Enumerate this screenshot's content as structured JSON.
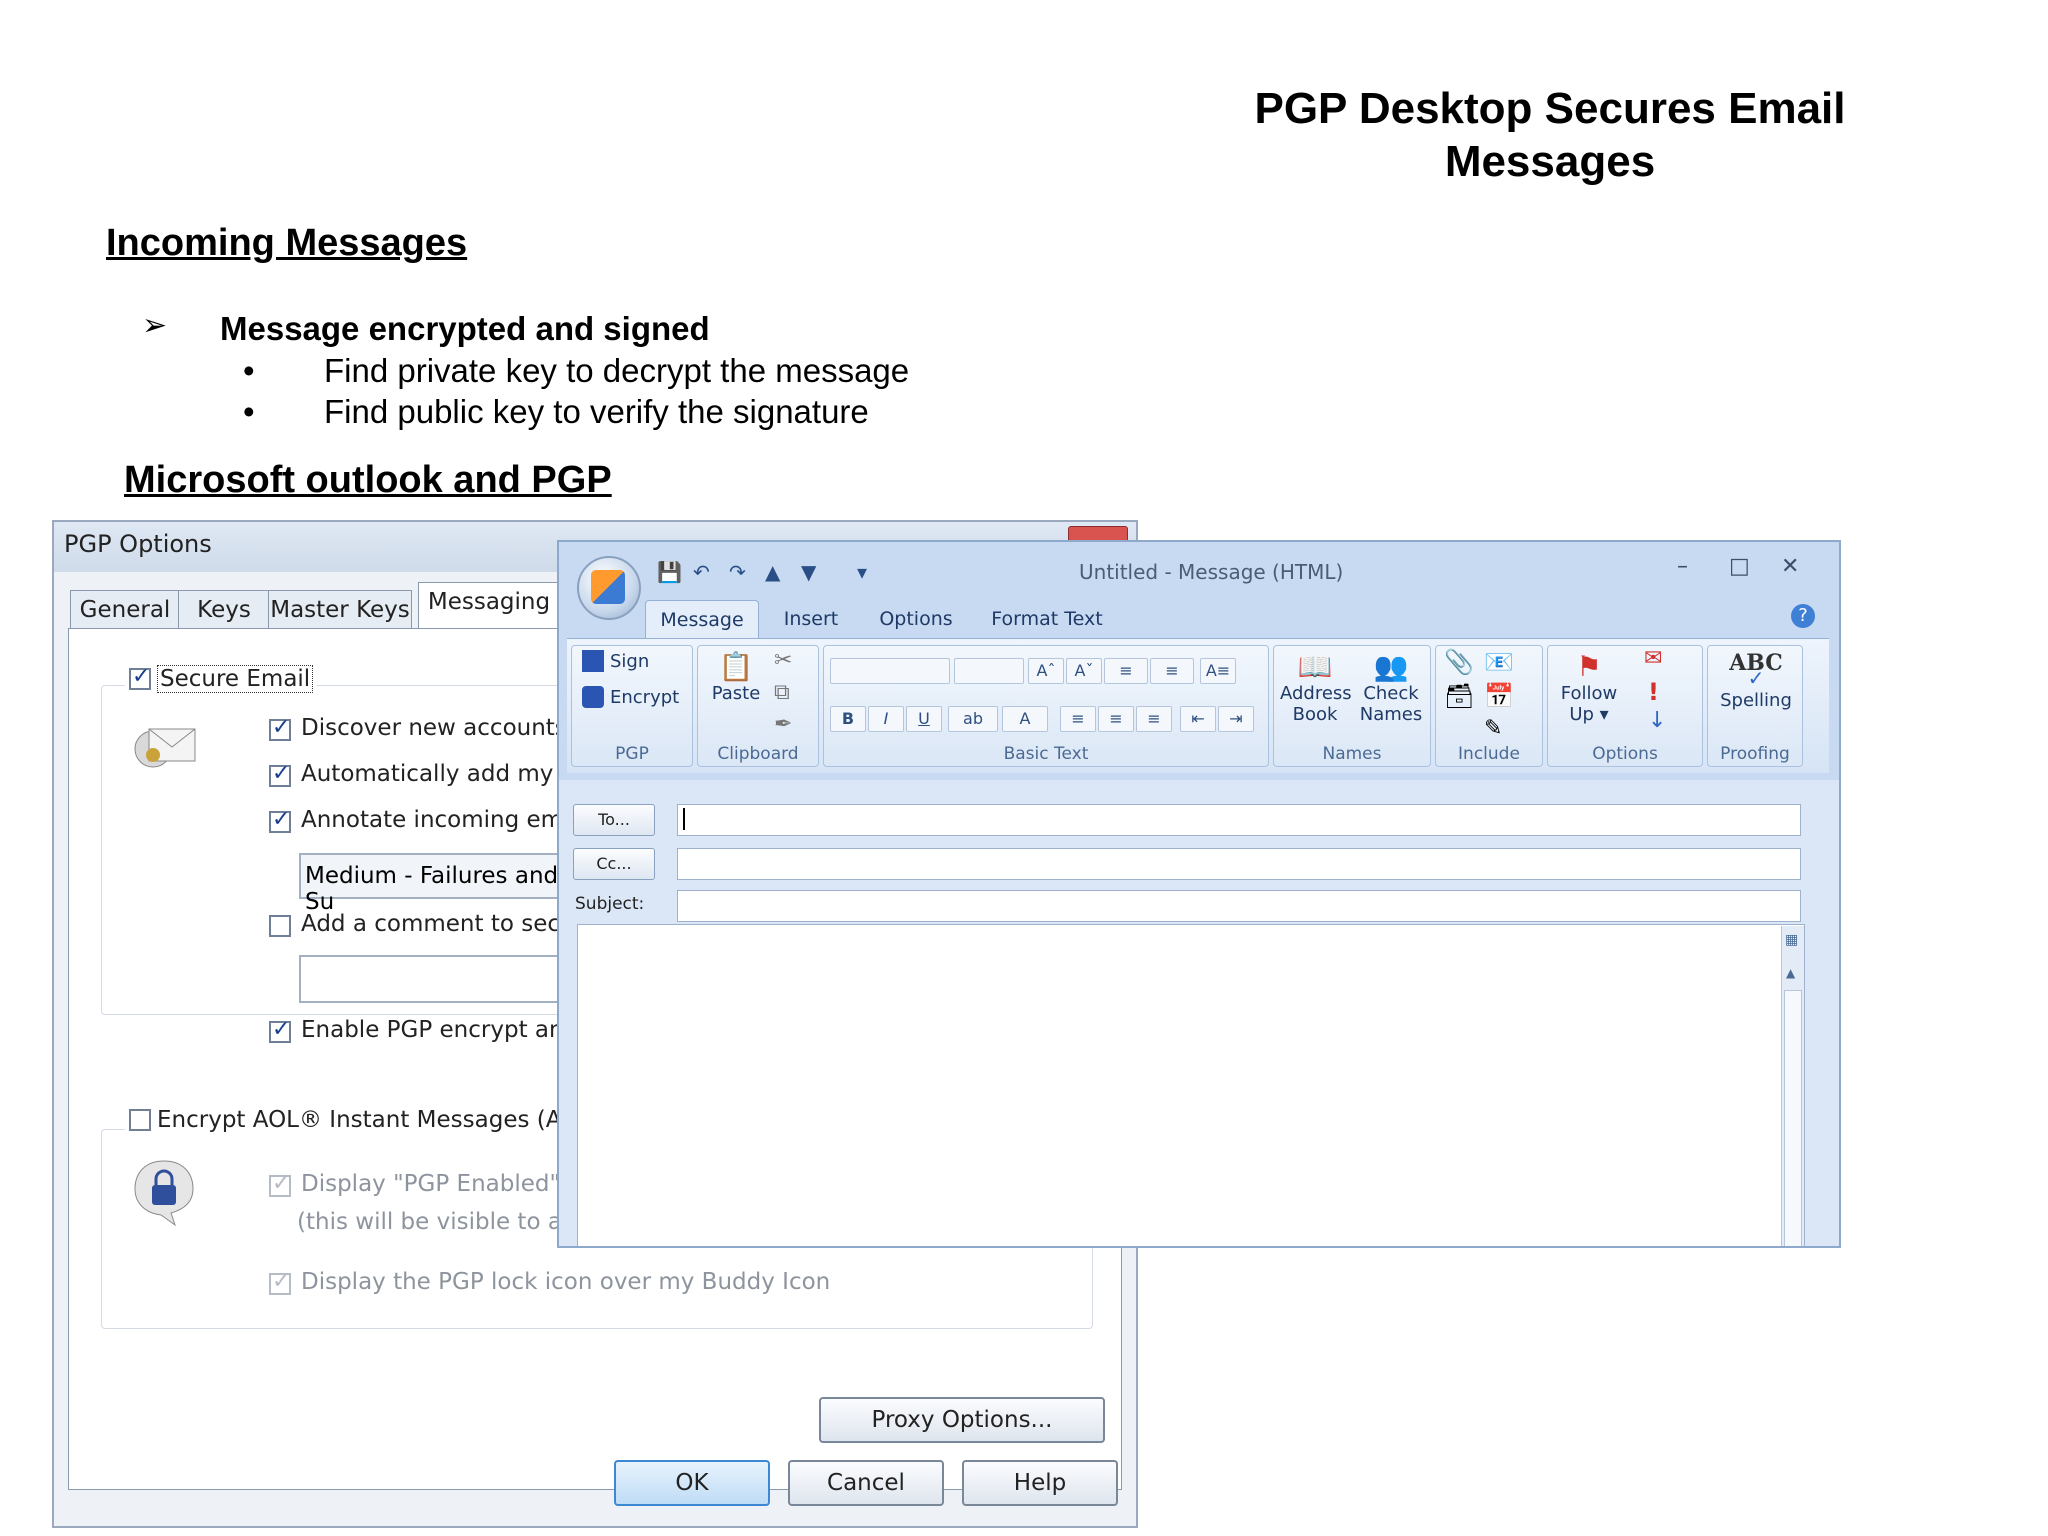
{
  "slide": {
    "title": "PGP Desktop Secures Email Messages",
    "heading1": "Incoming Messages",
    "bullet_marker": "➢",
    "bullet_main": "Message encrypted and signed",
    "sub_marker": "•",
    "sub_bullets": [
      "Find private key to decrypt the message",
      "Find public key to verify the signature"
    ],
    "heading2": "Microsoft outlook and PGP"
  },
  "pgp_dialog": {
    "title": "PGP Options",
    "tabs": [
      "General",
      "Keys",
      "Master Keys",
      "Messaging"
    ],
    "active_tab": "Messaging",
    "secure_email_label": "Secure Email",
    "secure_email_checked": true,
    "options": [
      {
        "label": "Discover new accounts",
        "checked": true
      },
      {
        "label": "Automatically add my em",
        "checked": true
      },
      {
        "label": "Annotate incoming email",
        "checked": true
      },
      {
        "label": "Add a comment to secure",
        "checked": false
      },
      {
        "label": "Enable PGP encrypt and",
        "checked": true
      }
    ],
    "annotate_level": "Medium - Failures and Su",
    "comment_value": "",
    "aim_label": "Encrypt AOL® Instant Messages (AIM",
    "aim_checked": false,
    "aim_options": [
      {
        "label": "Display \"PGP Enabled\" in",
        "checked": true,
        "disabled": true
      },
      {
        "label": "(this will be visible to all u",
        "note": true
      },
      {
        "label": "Display the PGP lock icon over my Buddy Icon",
        "checked": true,
        "disabled": true
      }
    ],
    "proxy_button": "Proxy Options...",
    "ok_button": "OK",
    "cancel_button": "Cancel",
    "help_button": "Help"
  },
  "outlook": {
    "window_title": "Untitled - Message (HTML)",
    "tabs": [
      "Message",
      "Insert",
      "Options",
      "Format Text"
    ],
    "active_tab": "Message",
    "groups": {
      "pgp": {
        "label": "PGP",
        "sign": "Sign",
        "encrypt": "Encrypt"
      },
      "clipboard": {
        "label": "Clipboard",
        "paste": "Paste"
      },
      "basic_text": {
        "label": "Basic Text"
      },
      "names": {
        "label": "Names",
        "address_book_1": "Address",
        "address_book_2": "Book",
        "check_names_1": "Check",
        "check_names_2": "Names"
      },
      "include": {
        "label": "Include"
      },
      "options": {
        "label": "Options",
        "follow_up_1": "Follow",
        "follow_up_2": "Up ▾"
      },
      "proofing": {
        "label": "Proofing",
        "spelling": "Spelling",
        "abc": "ABC"
      }
    },
    "to_button": "To...",
    "cc_button": "Cc...",
    "subject_label": "Subject:",
    "to_value": "",
    "cc_value": "",
    "subject_value": ""
  }
}
